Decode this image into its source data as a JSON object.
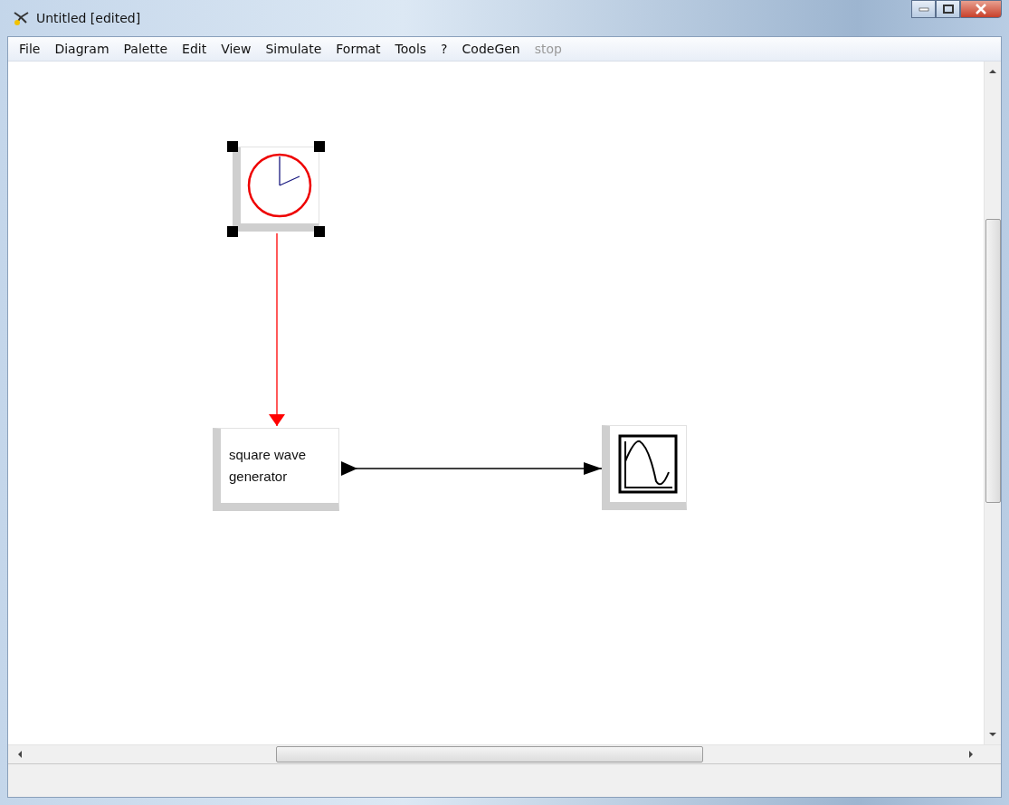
{
  "window": {
    "title": "Untitled [edited]"
  },
  "menu": [
    {
      "label": "File",
      "disabled": false
    },
    {
      "label": "Diagram",
      "disabled": false
    },
    {
      "label": "Palette",
      "disabled": false
    },
    {
      "label": "Edit",
      "disabled": false
    },
    {
      "label": "View",
      "disabled": false
    },
    {
      "label": "Simulate",
      "disabled": false
    },
    {
      "label": "Format",
      "disabled": false
    },
    {
      "label": "Tools",
      "disabled": false
    },
    {
      "label": "?",
      "disabled": false
    },
    {
      "label": "CodeGen",
      "disabled": false
    },
    {
      "label": "stop",
      "disabled": true
    }
  ],
  "diagram": {
    "blocks": [
      {
        "kind": "clock",
        "selected": true
      },
      {
        "kind": "text",
        "label": "square wave generator",
        "selected": false
      },
      {
        "kind": "scope",
        "selected": false
      }
    ],
    "links": [
      {
        "kind": "activation"
      },
      {
        "kind": "data"
      }
    ]
  }
}
